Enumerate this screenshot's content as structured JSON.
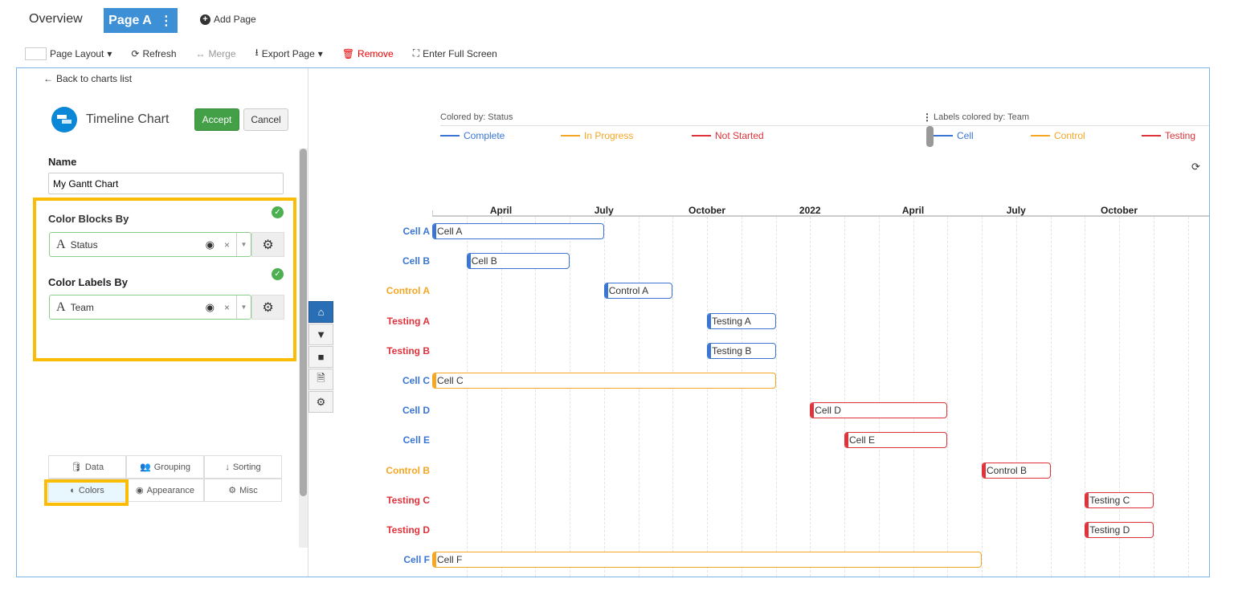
{
  "tabs": {
    "overview": "Overview",
    "page": "Page A",
    "add_page": "Add Page"
  },
  "toolbar": {
    "page_layout": "Page Layout",
    "refresh": "Refresh",
    "merge": "Merge",
    "export": "Export Page",
    "remove": "Remove",
    "fullscreen": "Enter Full Screen"
  },
  "editor": {
    "back": "Back to charts list",
    "chart_type": "Timeline Chart",
    "accept": "Accept",
    "cancel": "Cancel",
    "name_label": "Name",
    "name_value": "My Gantt Chart",
    "color_blocks_label": "Color Blocks By",
    "color_blocks_value": "Status",
    "color_labels_label": "Color Labels By",
    "color_labels_value": "Team",
    "panel_tabs": [
      {
        "label": "Data",
        "icon": "database-icon"
      },
      {
        "label": "Grouping",
        "icon": "users-icon"
      },
      {
        "label": "Sorting",
        "icon": "sort-icon"
      },
      {
        "label": "Colors",
        "icon": "contrast-icon",
        "active": true
      },
      {
        "label": "Appearance",
        "icon": "eye-icon"
      },
      {
        "label": "Misc",
        "icon": "gear-icon"
      }
    ]
  },
  "colors": {
    "complete": "#3a75d4",
    "in_progress": "#f5a623",
    "not_started": "#e0323a",
    "cell": "#3a75d4",
    "control": "#f5a623",
    "testing": "#e0323a",
    "highlight": "#fbbc05",
    "accent": "#3d8fd6"
  },
  "chart_data": {
    "type": "timeline",
    "legend_blocks": {
      "title": "Colored by: Status",
      "items": [
        {
          "label": "Complete",
          "color": "#3a75d4"
        },
        {
          "label": "In Progress",
          "color": "#f5a623"
        },
        {
          "label": "Not Started",
          "color": "#e0323a"
        }
      ]
    },
    "legend_labels": {
      "title": "Labels colored by: Team",
      "items": [
        {
          "label": "Cell",
          "color": "#3a75d4"
        },
        {
          "label": "Control",
          "color": "#f5a623"
        },
        {
          "label": "Testing",
          "color": "#e0323a"
        }
      ]
    },
    "x_range": [
      "2021-02",
      "2022-12"
    ],
    "ticks": [
      {
        "label": "April",
        "date": "2021-04"
      },
      {
        "label": "July",
        "date": "2021-07"
      },
      {
        "label": "October",
        "date": "2021-10"
      },
      {
        "label": "2022",
        "date": "2022-01"
      },
      {
        "label": "April",
        "date": "2022-04"
      },
      {
        "label": "July",
        "date": "2022-07"
      },
      {
        "label": "October",
        "date": "2022-10"
      }
    ],
    "rows": [
      {
        "label": "Cell A",
        "team": "Cell",
        "status": "Complete",
        "bar": "Cell A",
        "start": "2021-02",
        "end": "2021-07"
      },
      {
        "label": "Cell B",
        "team": "Cell",
        "status": "Complete",
        "bar": "Cell B",
        "start": "2021-03",
        "end": "2021-06"
      },
      {
        "label": "Control A",
        "team": "Control",
        "status": "Complete",
        "bar": "Control A",
        "start": "2021-07",
        "end": "2021-09"
      },
      {
        "label": "Testing A",
        "team": "Testing",
        "status": "Complete",
        "bar": "Testing A",
        "start": "2021-10",
        "end": "2021-12"
      },
      {
        "label": "Testing B",
        "team": "Testing",
        "status": "Complete",
        "bar": "Testing B",
        "start": "2021-10",
        "end": "2021-12"
      },
      {
        "label": "Cell C",
        "team": "Cell",
        "status": "In Progress",
        "bar": "Cell C",
        "start": "2021-02",
        "end": "2021-12"
      },
      {
        "label": "Cell D",
        "team": "Cell",
        "status": "Not Started",
        "bar": "Cell D",
        "start": "2022-01",
        "end": "2022-05"
      },
      {
        "label": "Cell E",
        "team": "Cell",
        "status": "Not Started",
        "bar": "Cell E",
        "start": "2022-02",
        "end": "2022-05"
      },
      {
        "label": "Control B",
        "team": "Control",
        "status": "Not Started",
        "bar": "Control B",
        "start": "2022-06",
        "end": "2022-08"
      },
      {
        "label": "Testing C",
        "team": "Testing",
        "status": "Not Started",
        "bar": "Testing C",
        "start": "2022-09",
        "end": "2022-11"
      },
      {
        "label": "Testing D",
        "team": "Testing",
        "status": "Not Started",
        "bar": "Testing D",
        "start": "2022-09",
        "end": "2022-11"
      },
      {
        "label": "Cell F",
        "team": "Cell",
        "status": "In Progress",
        "bar": "Cell F",
        "start": "2021-02",
        "end": "2022-06"
      }
    ]
  }
}
